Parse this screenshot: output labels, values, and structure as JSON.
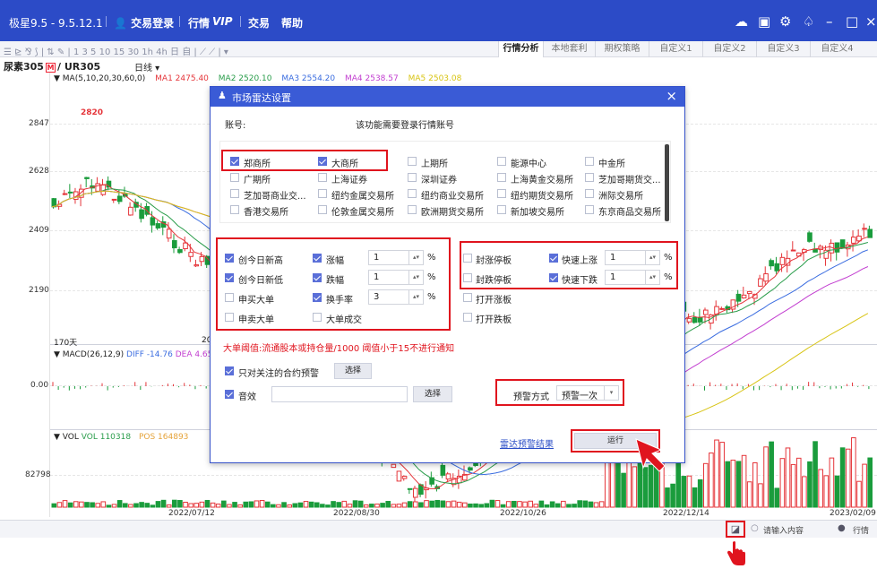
{
  "app": {
    "title": "极星9.5 - 9.5.12.1",
    "login": "交易登录",
    "menu": [
      "行情",
      "VIP",
      "交易",
      "帮助"
    ]
  },
  "toolbar": {
    "tools_text": "☰ ⊵ ⅋ ⟆ | ⇅ ✎ | 1 3 5 10 15 30 1h 4h 日 自 | ⟋ ⟋ | ▾",
    "tabs": [
      "行情分析",
      "本地套利",
      "期权策略",
      "自定义1",
      "自定义2",
      "自定义3",
      "自定义4"
    ]
  },
  "symbol": {
    "name": "尿素305",
    "badge": "M",
    "code": "/ UR305",
    "period": "日线 ▾"
  },
  "ma_legend": {
    "label": "▼ MA(5,10,20,30,60,0)",
    "ma1": "MA1 2475.40",
    "ma2": "MA2 2520.10",
    "ma3": "MA3 2554.20",
    "ma4": "MA4 2538.57",
    "ma5": "MA5 2503.08",
    "colors": {
      "ma1": "#e5353a",
      "ma2": "#2a9d4b",
      "ma3": "#3b6de0",
      "ma4": "#c23ed0",
      "ma5": "#d8c414"
    }
  },
  "price_axis": [
    "2847",
    "2628",
    "2409",
    "2190"
  ],
  "peak_label": "2820",
  "bars_label": "170天",
  "bars_label_right": "20",
  "macd_legend": {
    "label": "▼ MACD(26,12,9)",
    "diff": "DIFF -14.76",
    "dea": "DEA 4.65"
  },
  "macd_axis": "0.00",
  "vol_legend": {
    "label": "▼ VOL",
    "vol": "VOL 110318",
    "pos": "POS 164893"
  },
  "vol_axis": "82798",
  "dates": [
    "2022/07/12",
    "2022/08/30",
    "2022/10/26",
    "2022/12/14",
    "2023/02/09"
  ],
  "status": {
    "search_placeholder": "请输入内容",
    "quote_label": "行情"
  },
  "dialog": {
    "title": "市场雷达设置",
    "account_label": "账号:",
    "account_value": "该功能需要登录行情账号",
    "exchanges": [
      {
        "name": "郑商所",
        "checked": true
      },
      {
        "name": "大商所",
        "checked": true
      },
      {
        "name": "上期所",
        "checked": false
      },
      {
        "name": "能源中心",
        "checked": false
      },
      {
        "name": "中金所",
        "checked": false
      },
      {
        "name": "广期所",
        "checked": false
      },
      {
        "name": "上海证券",
        "checked": false
      },
      {
        "name": "深圳证券",
        "checked": false
      },
      {
        "name": "上海黄金交易所",
        "checked": false
      },
      {
        "name": "芝加哥期货交...",
        "checked": false
      },
      {
        "name": "芝加哥商业交...",
        "checked": false
      },
      {
        "name": "纽约金属交易所",
        "checked": false
      },
      {
        "name": "纽约商业交易所",
        "checked": false
      },
      {
        "name": "纽约期货交易所",
        "checked": false
      },
      {
        "name": "洲际交易所",
        "checked": false
      },
      {
        "name": "香港交易所",
        "checked": false
      },
      {
        "name": "伦敦金属交易所",
        "checked": false
      },
      {
        "name": "欧洲期货交易所",
        "checked": false
      },
      {
        "name": "新加坡交易所",
        "checked": false
      },
      {
        "name": "东京商品交易所",
        "checked": false
      }
    ],
    "conditions_left": [
      {
        "name": "创今日新高",
        "checked": true
      },
      {
        "name": "创今日新低",
        "checked": true
      },
      {
        "name": "申买大单",
        "checked": false
      },
      {
        "name": "申卖大单",
        "checked": false
      }
    ],
    "conditions_mid": [
      {
        "name": "涨幅",
        "checked": true,
        "value": "1",
        "unit": "%"
      },
      {
        "name": "跌幅",
        "checked": true,
        "value": "1",
        "unit": "%"
      },
      {
        "name": "换手率",
        "checked": true,
        "value": "3",
        "unit": "%"
      },
      {
        "name": "大单成交",
        "checked": false,
        "value": "",
        "unit": ""
      }
    ],
    "conditions_right": [
      {
        "name": "封涨停板",
        "checked": false
      },
      {
        "name": "封跌停板",
        "checked": false
      },
      {
        "name": "打开涨板",
        "checked": false
      },
      {
        "name": "打开跌板",
        "checked": false
      }
    ],
    "conditions_far": [
      {
        "name": "快速上涨",
        "checked": true,
        "value": "1",
        "unit": "%"
      },
      {
        "name": "快速下跌",
        "checked": true,
        "value": "1",
        "unit": "%"
      }
    ],
    "notice": "大单阈值:流通股本或持仓量/1000 阈值小于15不进行通知",
    "watch_label": "只对关注的合约预警",
    "watch_checked": true,
    "select_label": "选择",
    "sound_label": "音效",
    "sound_checked": true,
    "sound_value": "",
    "sound_select_label": "选择",
    "alert_mode_label": "预警方式",
    "alert_mode_value": "预警一次",
    "results_link": "雷达预警结果",
    "run_label": "运行"
  }
}
